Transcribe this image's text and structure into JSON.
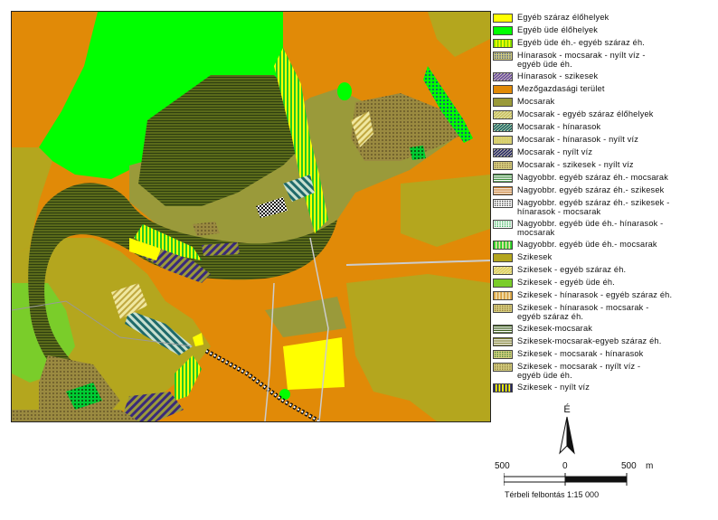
{
  "legend": {
    "items": [
      {
        "label": "Egyéb száraz élőhelyek",
        "icon": "solid-yellow",
        "color": "#ffff00",
        "lines": 1
      },
      {
        "label": "Egyéb üde élőhelyek",
        "icon": "solid-green",
        "color": "#00ff00",
        "lines": 1
      },
      {
        "label": "Egyéb üde éh.- egyéb száraz éh.",
        "icon": "green-yellow-vstripes",
        "color": "#7ad600",
        "lines": 1
      },
      {
        "label": "Hínarasok - mocsarak - nyílt víz -\negyéb üde éh.",
        "icon": "blue-dotted",
        "color": "#1a3a8a",
        "lines": 2
      },
      {
        "label": "Hínarasok - szikesek",
        "icon": "purple-olive-stripes",
        "color": "#6a4aa0",
        "lines": 1
      },
      {
        "label": "Mezőgazdasági terület",
        "icon": "solid-orange",
        "color": "#e18a07",
        "lines": 1
      },
      {
        "label": "Mocsarak",
        "icon": "solid-olive",
        "color": "#9a9a3a",
        "lines": 1
      },
      {
        "label": "Mocsarak - egyéb száraz élőhelyek",
        "icon": "olive-yellow-diag",
        "color": "#c8c060",
        "lines": 1
      },
      {
        "label": "Mocsarak - hínarasok",
        "icon": "teal-stripes",
        "color": "#1f6a6a",
        "lines": 1
      },
      {
        "label": "Mocsarak - hínarasok - nyílt víz",
        "icon": "dotted-yellow",
        "color": "#d8d040",
        "lines": 1
      },
      {
        "label": "Mocsarak - nyílt víz",
        "icon": "navy-diag",
        "color": "#2a2a6a",
        "lines": 1
      },
      {
        "label": "Mocsarak - szikesek - nyílt víz",
        "icon": "brown-dots",
        "color": "#8a7040",
        "lines": 1
      },
      {
        "label": "Nagyobbr. egyéb száraz éh.- mocsarak",
        "icon": "green-hlines",
        "color": "#3a8a3a",
        "lines": 1
      },
      {
        "label": "Nagyobbr. egyéb száraz éh.- szikesek",
        "icon": "orange-hlines",
        "color": "#c87a2a",
        "lines": 1
      },
      {
        "label": "Nagyobbr. egyéb száraz éh.- szikesek -\nhínarasok - mocsarak",
        "icon": "black-dots",
        "color": "#222222",
        "lines": 2
      },
      {
        "label": "Nagyobbr. egyéb üde éh.- hínarasok -\nmocsarak",
        "icon": "green-black-dots",
        "color": "#009a2a",
        "lines": 2
      },
      {
        "label": "Nagyobbr. egyéb üde éh.- mocsarak",
        "icon": "bright-green-vstripes",
        "color": "#22cc22",
        "lines": 1
      },
      {
        "label": "Szikesek",
        "icon": "solid-olive-light",
        "color": "#b4a61e",
        "lines": 1
      },
      {
        "label": "Szikesek - egyéb száraz éh.",
        "icon": "yellow-diag",
        "color": "#e0d060",
        "lines": 1
      },
      {
        "label": "Szikesek - egyéb üde éh.",
        "icon": "solid-light-green",
        "color": "#7acd2a",
        "lines": 1
      },
      {
        "label": "Szikesek - hínarasok - egyéb száraz éh.",
        "icon": "orange-vstripes",
        "color": "#d8a040",
        "lines": 1
      },
      {
        "label": "Szikesek - hínarasok - mocsarak -\negyéb száraz éh.",
        "icon": "brown-crosshatch",
        "color": "#8a6a2a",
        "lines": 2
      },
      {
        "label": "Szikesek-mocsarak",
        "icon": "darkgreen-hlines",
        "color": "#3a5a1a",
        "lines": 1
      },
      {
        "label": "Szikesek-mocsarak-egyeb száraz éh.",
        "icon": "olive-hlines",
        "color": "#7a7a2a",
        "lines": 1
      },
      {
        "label": "Szikesek - mocsarak - hínarasok",
        "icon": "green-crosshatch",
        "color": "#2a7a2a",
        "lines": 1
      },
      {
        "label": "Szikesek - mocsarak - nyílt víz -\negyéb üde éh.",
        "icon": "brown-weave",
        "color": "#7a6a30",
        "lines": 2
      },
      {
        "label": "Szikesek - nyílt víz",
        "icon": "navy-yellow-vstripes",
        "color": "#22226a",
        "lines": 1
      }
    ]
  },
  "north_arrow": {
    "letter": "É",
    "icon": "north-arrow-icon"
  },
  "scale": {
    "left": "500",
    "mid": "0",
    "right": "500",
    "unit": "m",
    "segments": [
      500,
      0,
      500
    ]
  },
  "resolution_text": "Térbeli felbontás 1:15 000",
  "colors": {
    "agriculture": "#e18a07",
    "saline": "#b4a61e",
    "marsh": "#9a9a3a",
    "wet_green": "#00ff00",
    "dry_yellow": "#ffff00",
    "dark_marsh": "#4a5a1a",
    "saline_wet": "#7acd2a",
    "water_navy": "#22226a"
  }
}
